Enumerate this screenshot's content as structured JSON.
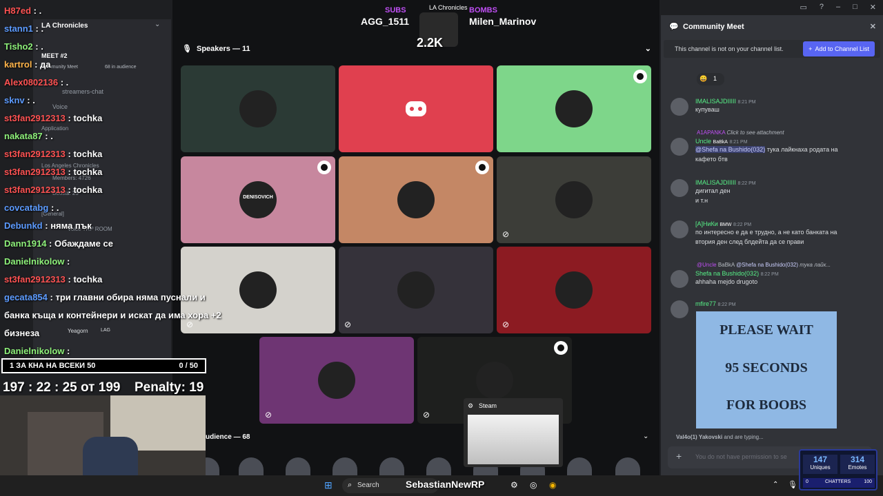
{
  "header": {
    "subs": "SUBS",
    "channel": "LA Chronicles",
    "bombs": "BOMBS",
    "left_name": "AGG_1511",
    "right_name": "Milen_Marinov",
    "count": "2.2K"
  },
  "stage": {
    "speakers_label": "Speakers — 11",
    "audience_label": "udience — 68"
  },
  "tiles": [
    {
      "name": "tile-shark",
      "bg": "#2b3a35"
    },
    {
      "name": "tile-discord",
      "bg": "#e0404f"
    },
    {
      "name": "tile-skeleton",
      "bg": "#7ed68a"
    },
    {
      "name": "tile-denisovich",
      "bg": "#c7879e",
      "text": "DENISOVICH"
    },
    {
      "name": "tile-man",
      "bg": "#c48765"
    },
    {
      "name": "tile-car",
      "bg": "#3c3d38"
    },
    {
      "name": "tile-cat",
      "bg": "#d4d2cc"
    },
    {
      "name": "tile-bunny",
      "bg": "#35323a"
    },
    {
      "name": "tile-red-mask",
      "bg": "#8c1b22"
    },
    {
      "name": "tile-purple-cat",
      "bg": "#6e3573"
    },
    {
      "name": "tile-hacker",
      "bg": "#1e1f1e"
    }
  ],
  "right": {
    "title": "Community Meet",
    "notice": "This channel is not on your channel list.",
    "add_button": "Add to Channel List",
    "reaction_count": "1",
    "typing": "and are typing...",
    "typing_a": "Val4o(1)",
    "typing_b": "Yakovski",
    "input_placeholder": "You do not have permission to se"
  },
  "messages": [
    {
      "user": "IMALISAJDIIIII",
      "time": "8:21 PM",
      "text": "купуваш"
    },
    {
      "reply_user": "A1APANKA",
      "reply_text": "Click to see attachment",
      "user": "Uncle",
      "tag": "BaBkA",
      "time": "8:21 PM",
      "mention": "@Shefa na Bushido(032)",
      "text": "тука лайкнаха родата на",
      "text2": "кафето бтв"
    },
    {
      "user": "IMALISAJDIIIII",
      "time": "8:22 PM",
      "text": "дигитал ден",
      "text2": "и т.н"
    },
    {
      "user": "[A]НиКи",
      "tag": "BMW",
      "time": "8:22 PM",
      "text": "по интересно е да е трудно, а не като банката на",
      "text2": "втория ден след блдейта да се прави"
    },
    {
      "reply_user": "@Uncle",
      "reply_tag": "BaBkA",
      "reply_mention": "@Shefa na Bushido(032)",
      "reply_text": "тука лайк...",
      "user": "Shefa na Bushido(032)",
      "time": "8:22 PM",
      "text": "ahhaha mejdo drugoto"
    },
    {
      "user": "mfire77",
      "time": "8:22 PM"
    }
  ],
  "wait_image": {
    "l1": "PLEASE WAIT",
    "l2": "95 SECONDS",
    "l3": "FOR BOOBS"
  },
  "chat": [
    {
      "user": "H87ed",
      "text": ": ."
    },
    {
      "user": "stann1",
      "text": ": ."
    },
    {
      "user": "Tisho2",
      "text": ": ."
    },
    {
      "user": "kartrol",
      "text": ": да"
    },
    {
      "user": "Alex0802136",
      "text": ": ."
    },
    {
      "user": "sknv",
      "text": ": ."
    },
    {
      "user": "st3fan2912313",
      "text": ": tochka"
    },
    {
      "user": "nakata87",
      "text": ": ."
    },
    {
      "user": "st3fan2912313",
      "text": ": tochka"
    },
    {
      "user": "st3fan2912313",
      "text": ": tochka"
    },
    {
      "user": "st3fan2912313",
      "text": ": tochka"
    },
    {
      "user": "covcatabg",
      "text": ": ."
    },
    {
      "user": "Debunkd",
      "text": ": няма пък"
    },
    {
      "user": "Dann1914",
      "text": ": Обаждаме се"
    },
    {
      "user": "Danielnikolow",
      "text": ":"
    },
    {
      "user": "st3fan2912313",
      "text": ": tochka"
    },
    {
      "user": "gecata854",
      "text": ": три главни обира няма пуснали и"
    },
    {
      "text": "банка къща и контейнери и искат да има хора +2"
    },
    {
      "text": "бизнеза"
    },
    {
      "user": "Danielnikolow",
      "text": ":"
    }
  ],
  "sidebar": {
    "server": "LA Chronicles",
    "meet": "MEET #2",
    "community": "Community Meet",
    "audience": "68 in audience",
    "streamers": "streamers-chat",
    "voice": "Voice",
    "application": "Application",
    "members": "Members: 4726",
    "boosts": "Boosts: 25",
    "general": "[General]",
    "trp": "Voice TRP ROOM",
    "la_cross": "Los Angeles Chronicles",
    "yeagorn": "Yeagorn",
    "lag": "LAG"
  },
  "overlay": {
    "progress": "1 ЗА КНА НА ВСЕКИ 50",
    "progress_count": "0 / 50",
    "timer": "197 : 22 : 25",
    "timer_suffix": "от 199",
    "penalty": "Penalty: 19"
  },
  "stats": {
    "uniques": "147",
    "uniques_label": "Uniques",
    "emotes": "314",
    "emotes_label": "Emotes",
    "chatters_label": "CHATTERS",
    "chatters_min": "0",
    "chatters_max": "100"
  },
  "taskbar": {
    "search": "Search",
    "stream_title": "SebastianNewRP"
  },
  "steam": {
    "label": "Steam"
  }
}
